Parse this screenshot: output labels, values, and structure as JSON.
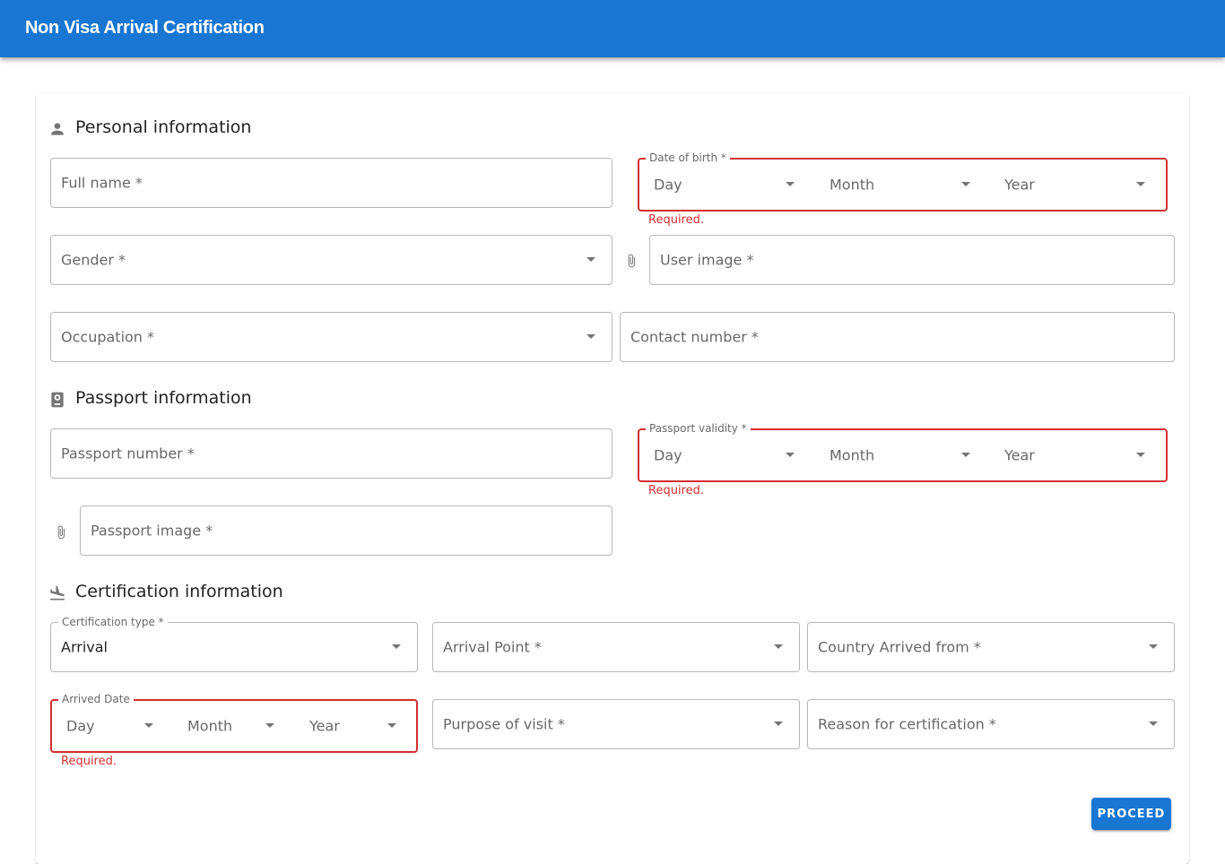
{
  "appbar": {
    "title": "Non Visa Arrival Certification"
  },
  "personal": {
    "title": "Personal information",
    "full_name": "Full name *",
    "dob_label": "Date of birth *",
    "dob_day": "Day",
    "dob_month": "Month",
    "dob_year": "Year",
    "dob_error": "Required.",
    "gender": "Gender *",
    "user_image": "User image *",
    "occupation": "Occupation *",
    "contact_number": "Contact number *"
  },
  "passport": {
    "title": "Passport information",
    "number": "Passport number *",
    "validity_label": "Passport validity *",
    "validity_day": "Day",
    "validity_month": "Month",
    "validity_year": "Year",
    "validity_error": "Required.",
    "image": "Passport image *"
  },
  "certification": {
    "title": "Certification information",
    "type_label": "Certification type *",
    "type_value": "Arrival",
    "arrival_point": "Arrival Point *",
    "country_from": "Country Arrived from *",
    "arrived_label": "Arrived Date",
    "arrived_day": "Day",
    "arrived_month": "Month",
    "arrived_year": "Year",
    "arrived_error": "Required.",
    "purpose": "Purpose of visit *",
    "reason": "Reason for certification *"
  },
  "actions": {
    "proceed": "PROCEED"
  },
  "icons": {
    "personal": "person-icon",
    "passport": "passport-icon",
    "certification": "flight-land-icon",
    "attach": "paperclip-icon"
  },
  "colors": {
    "primary": "#1976d2",
    "error": "#d32f2f"
  }
}
